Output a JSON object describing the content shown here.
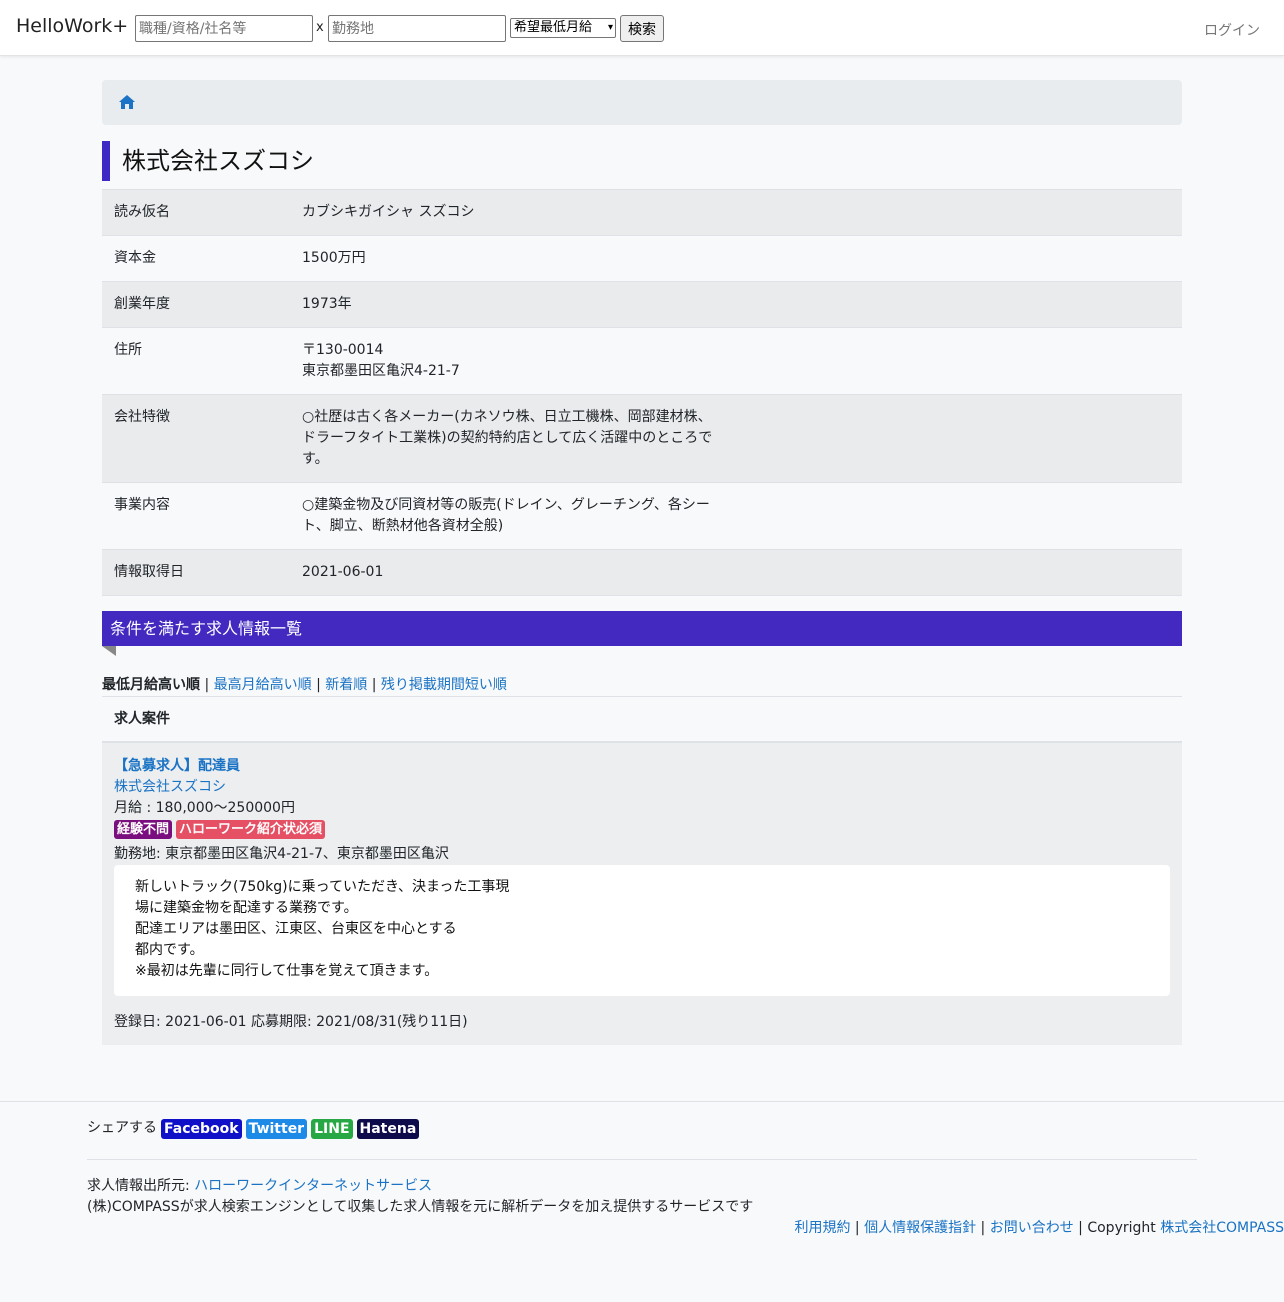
{
  "header": {
    "brand": "HelloWork+",
    "keyword_placeholder": "職種/資格/社名等",
    "separator": "x",
    "location_placeholder": "勤務地",
    "salary_select": "希望最低月給",
    "search_label": "検索",
    "login_label": "ログイン"
  },
  "company": {
    "title": "株式会社スズコシ",
    "rows": [
      {
        "key": "読み仮名",
        "value": "カブシキガイシャ スズコシ"
      },
      {
        "key": "資本金",
        "value": "1500万円"
      },
      {
        "key": "創業年度",
        "value": "1973年"
      },
      {
        "key": "住所",
        "value": "〒130-0014\n東京都墨田区亀沢4-21-7"
      },
      {
        "key": "会社特徴",
        "value": "○社歴は古く各メーカー(カネソウ株、日立工機株、岡部建材株、\nドラーフタイト工業株)の契約特約店として広く活躍中のところで\nす。"
      },
      {
        "key": "事業内容",
        "value": "○建築金物及び同資材等の販売(ドレイン、グレーチング、各シー\nト、脚立、断熱材他各資材全般)"
      },
      {
        "key": "情報取得日",
        "value": "2021-06-01"
      }
    ]
  },
  "jobs_section": {
    "header": "条件を満たす求人情報一覧",
    "sort": {
      "active": "最低月給高い順",
      "links": [
        "最高月給高い順",
        "新着順",
        "残り掲載期間短い順"
      ],
      "separator": "|"
    },
    "list_header": "求人案件",
    "jobs": [
      {
        "title": "【急募求人】配達員",
        "company": "株式会社スズコシ",
        "salary": "月給 : 180,000〜250000円",
        "badges": [
          "経験不問",
          "ハローワーク紹介状必須"
        ],
        "location": "勤務地: 東京都墨田区亀沢4-21-7、東京都墨田区亀沢",
        "description": "新しいトラック(750kg)に乗っていただき、決まった工事現\n場に建築金物を配達する業務です。\n配達エリアは墨田区、江東区、台東区を中心とする\n都内です。\n※最初は先輩に同行して仕事を覚えて頂きます。",
        "dates": "登録日: 2021-06-01 応募期限: 2021/08/31(残り11日)"
      }
    ]
  },
  "footer": {
    "share_label": "シェアする",
    "share_buttons": [
      "Facebook",
      "Twitter",
      "LINE",
      "Hatena"
    ],
    "source_label": "求人情報出所元: ",
    "source_link": "ハローワークインターネットサービス",
    "about": "(株)COMPASSが求人検索エンジンとして収集した求人情報を元に解析データを加え提供するサービスです",
    "links": [
      "利用規約",
      "個人情報保護指針",
      "お問い合わせ"
    ],
    "separator": "|",
    "copyright_label": "Copyright",
    "copyright_link": "株式会社COMPASS"
  },
  "colors": {
    "accent": "#4329c0",
    "link": "#1a73c4",
    "badge_purple": "#7a0e7e",
    "badge_red": "#e55064"
  },
  "icons": {
    "home": "home-icon",
    "select_caret": "chevron-down-icon"
  }
}
